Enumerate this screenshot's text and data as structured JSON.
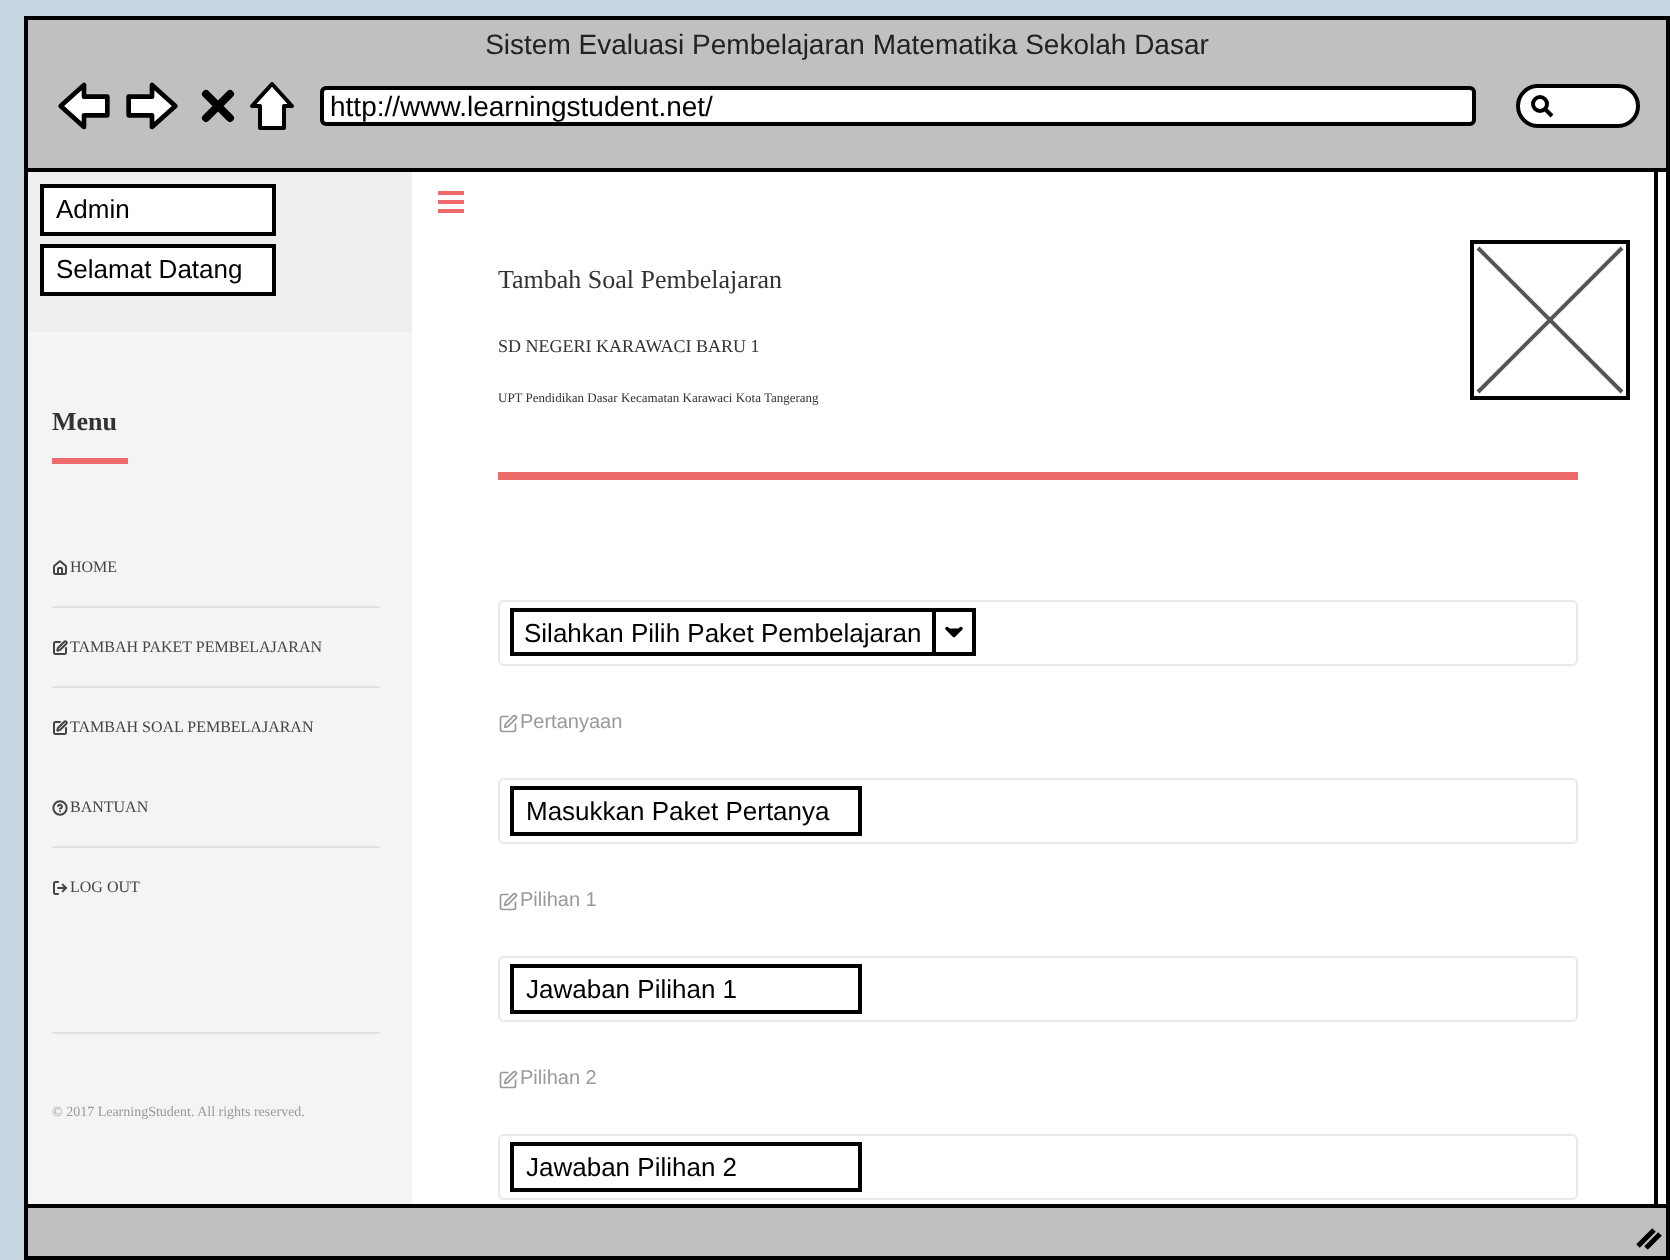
{
  "window": {
    "title": "Sistem Evaluasi Pembelajaran Matematika Sekolah Dasar",
    "url": "http://www.learningstudent.net/"
  },
  "sidebar": {
    "user_boxes": [
      "Admin",
      "Selamat Datang"
    ],
    "menu_title": "Menu",
    "items": [
      {
        "label": "HOME",
        "kind": "home",
        "divider_below": true
      },
      {
        "label": "TAMBAH PAKET PEMBELAJARAN",
        "kind": "edit",
        "divider_below": true
      },
      {
        "label": "TAMBAH SOAL PEMBELAJARAN",
        "kind": "edit",
        "divider_below": false
      },
      {
        "label": "BANTUAN",
        "kind": "help",
        "divider_below": true
      },
      {
        "label": "LOG OUT",
        "kind": "logout",
        "divider_below": false
      }
    ],
    "footer": "© 2017 LearningStudent. All rights reserved."
  },
  "main": {
    "title": "Tambah Soal Pembelajaran",
    "school": "SD NEGERI KARAWACI BARU 1",
    "subtitle": "UPT Pendidikan Dasar Kecamatan Karawaci Kota Tangerang",
    "select": {
      "value": "Silahkan Pilih Paket Pembelajaran"
    },
    "fields": [
      {
        "label": "Pertanyaan",
        "value": "Masukkan Paket Pertanya"
      },
      {
        "label": "Pilihan 1",
        "value": "Jawaban Pilihan 1"
      },
      {
        "label": "Pilihan 2",
        "value": "Jawaban Pilihan 2"
      }
    ]
  }
}
